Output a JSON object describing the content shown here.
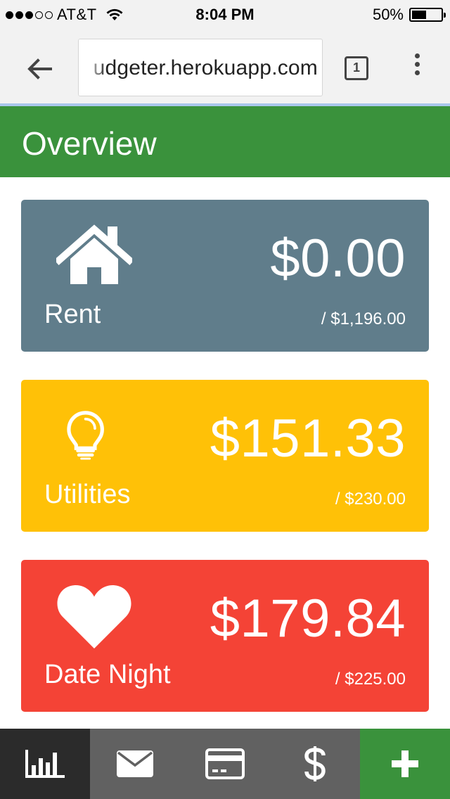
{
  "status_bar": {
    "carrier": "AT&T",
    "signal_bars": 3,
    "time": "8:04 PM",
    "battery_percent": "50%",
    "battery_level": 0.5
  },
  "browser": {
    "url": "udgeter.herokuapp.com",
    "tab_count": "1",
    "icons": {
      "back": "arrow-left-icon",
      "tabs": "tabs-count-icon",
      "menu": "more-vertical-icon"
    }
  },
  "header": {
    "title": "Overview",
    "color": "#3a923c"
  },
  "budgets": [
    {
      "label": "Rent",
      "amount": "$0.00",
      "limit": "/ $1,196.00",
      "icon": "house-icon",
      "color": "#607d8b"
    },
    {
      "label": "Utilities",
      "amount": "$151.33",
      "limit": "/ $230.00",
      "icon": "lightbulb-icon",
      "color": "#ffc107"
    },
    {
      "label": "Date Night",
      "amount": "$179.84",
      "limit": "/ $225.00",
      "icon": "heart-icon",
      "color": "#f44336"
    }
  ],
  "bottom_nav": [
    {
      "icon": "bar-chart-icon",
      "color": "#2b2b2b",
      "active": true
    },
    {
      "icon": "envelope-icon",
      "color": "#616161",
      "active": false
    },
    {
      "icon": "credit-card-icon",
      "color": "#616161",
      "active": false
    },
    {
      "icon": "dollar-icon",
      "color": "#616161",
      "active": false
    },
    {
      "icon": "plus-icon",
      "color": "#3a923c",
      "active": false
    }
  ]
}
